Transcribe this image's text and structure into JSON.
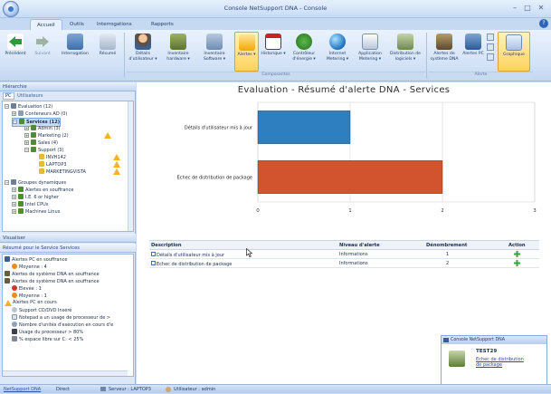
{
  "window": {
    "title": "Console NetSupport DNA - Console",
    "controls": [
      "–",
      "□",
      "✕"
    ]
  },
  "tabs": [
    "Accueil",
    "Outils",
    "Interrogations",
    "Rapports"
  ],
  "help_label": "?",
  "ribbon": {
    "buttons": [
      {
        "label": "Précédent",
        "icon": "back-arrow-icon"
      },
      {
        "label": "Suivant",
        "icon": "forward-arrow-icon"
      },
      {
        "label": "Interrogation",
        "icon": "query-icon"
      },
      {
        "label": "Résumé",
        "icon": "summary-icon"
      },
      {
        "label": "Détails d'utilisateur ▾",
        "icon": "user-details-icon"
      },
      {
        "label": "Inventaire hardware ▾",
        "icon": "hardware-icon"
      },
      {
        "label": "Inventaire Software ▾",
        "icon": "software-icon"
      },
      {
        "label": "Alertes ▾",
        "icon": "alert-bell-icon"
      },
      {
        "label": "Historique ▾",
        "icon": "calendar-icon"
      },
      {
        "label": "Contrôleur d'énergie ▾",
        "icon": "power-icon"
      },
      {
        "label": "Internet Metering ▾",
        "icon": "globe-icon"
      },
      {
        "label": "Application Metering ▾",
        "icon": "application-icon"
      },
      {
        "label": "Distribution de logiciels ▾",
        "icon": "distribution-icon"
      },
      {
        "label": "Alertes de système DNA",
        "icon": "system-alert-icon"
      },
      {
        "label": "Alertes PC",
        "icon": "pc-alert-icon"
      },
      {
        "label": "Graphique",
        "icon": "chart-icon"
      }
    ],
    "group_components": "Composantes",
    "group_alerts": "Alerte"
  },
  "left": {
    "hierarchy_header": "Hiérarchie",
    "hierarchy_tabs": [
      "PC",
      "Utilisateurs"
    ],
    "tree": [
      "Evaluation (12)",
      "Conteneurs AD (0)",
      "Services (12)",
      "Admin (3)",
      "Marketing (2)",
      "Sales (4)",
      "Support (3)",
      "INVH142",
      "LAPTOP3",
      "MARKETINGVISTA",
      "Groupes dynamiques",
      "Alertes en souffrance",
      "I.E. 6 or higher",
      "Intel CPUs",
      "Machines Linux"
    ],
    "view_header": "Visualiser",
    "summary_title": "Résumé pour le Service Services",
    "summary": [
      "Alertes PC en souffrance",
      "Moyenne : 4",
      "Alertes de système DNA en souffrance",
      "Alertes de système DNA en souffrance",
      "Elevée : 1",
      "Moyenne : 1",
      "Alertes PC en cours",
      "Support CD/DVD Inséré",
      "Notepad a un usage de processeur de >",
      "Nombre d'unités d'exécution en cours d'e",
      "Usage du processeur > 80%",
      "% espace libre sur C: < 25%"
    ]
  },
  "main": {
    "title": "Evaluation - Résumé d'alerte DNA - Services",
    "table": {
      "headers": [
        "Description",
        "Niveau d'alerte",
        "Dénombrement",
        "Action"
      ],
      "rows": [
        {
          "desc": "Détails d'utilisateur mis à jour",
          "level": "Informations",
          "count": "1"
        },
        {
          "desc": "Echec de distribution de package",
          "level": "Informations",
          "count": "2"
        }
      ]
    }
  },
  "chart_data": {
    "type": "bar",
    "orientation": "horizontal",
    "title": "Evaluation - Résumé d'alerte DNA - Services",
    "categories": [
      "Détails d'utilisateur mis à jour",
      "Echec de distribution de package"
    ],
    "values": [
      1,
      2
    ],
    "colors": [
      "#2e7fc0",
      "#d1542f"
    ],
    "xlim": [
      0,
      3
    ],
    "xticks": [
      "0",
      "1",
      "2",
      "3"
    ],
    "grid": true
  },
  "popup": {
    "title": "Console NetSupport DNA",
    "machine": "TEST29",
    "message": "Echec de distribution de package"
  },
  "status": [
    "NetSupport DNA",
    "Direct",
    "Serveur : LAPTOP3",
    "Utilisateur : admin"
  ],
  "colors": {
    "accent": "#2e65b9",
    "highlight": "#ffd25a",
    "bar1": "#2e7fc0",
    "bar2": "#d1542f",
    "add": "#3aa63a"
  }
}
